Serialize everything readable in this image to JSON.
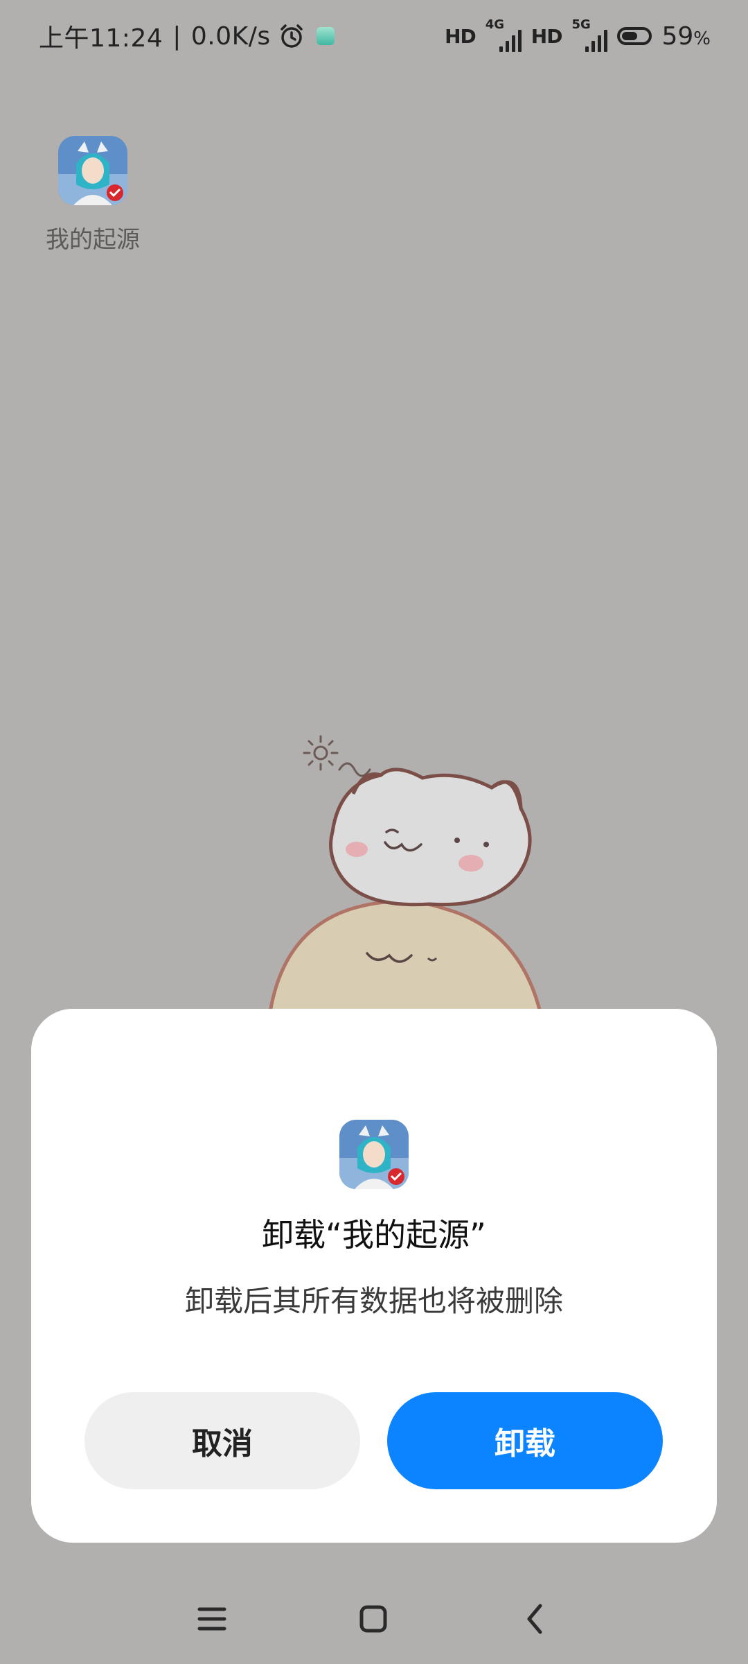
{
  "status_bar": {
    "time": "上午11:24",
    "separator": "|",
    "net_speed": "0.0K/s",
    "sim1": {
      "label": "HD",
      "network": "4G"
    },
    "sim2": {
      "label": "HD",
      "network": "5G"
    },
    "battery_level": 0.59,
    "battery_percent": "59",
    "battery_unit": "%",
    "icons": [
      "alarm-icon",
      "notification-badge-icon",
      "signal-icon",
      "battery-icon"
    ]
  },
  "home": {
    "app_label": "我的起源"
  },
  "dialog": {
    "title": "卸载“我的起源”",
    "message": "卸载后其所有数据也将被删除",
    "cancel_label": "取消",
    "confirm_label": "卸载",
    "confirm_color": "#0d84ff",
    "cancel_color": "#efefef"
  },
  "nav_bar": {
    "icons": [
      "menu-icon",
      "home-icon",
      "back-icon"
    ]
  },
  "colors": {
    "scrim": "#b2afaf",
    "accent": "#0d84ff"
  }
}
